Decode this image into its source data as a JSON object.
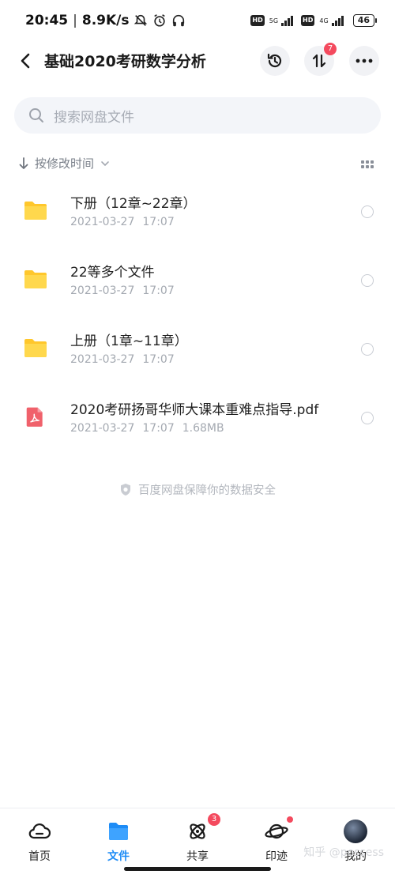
{
  "status_bar": {
    "time": "20:45",
    "net_speed": "8.9K/s",
    "battery": "46",
    "sim1": {
      "badge": "HD",
      "net": "5G"
    },
    "sim2": {
      "badge": "HD",
      "net": "4G"
    }
  },
  "header": {
    "title": "基础2020考研数学分析",
    "transfer_badge": "7"
  },
  "search": {
    "placeholder": "搜索网盘文件"
  },
  "sort": {
    "label": "按修改时间"
  },
  "files": [
    {
      "name": "下册（12章~22章）",
      "date": "2021-03-27",
      "time": "17:07",
      "size": "",
      "type": "folder"
    },
    {
      "name": "22等多个文件",
      "date": "2021-03-27",
      "time": "17:07",
      "size": "",
      "type": "folder"
    },
    {
      "name": "上册（1章~11章）",
      "date": "2021-03-27",
      "time": "17:07",
      "size": "",
      "type": "folder"
    },
    {
      "name": "2020考研扬哥华师大课本重难点指导.pdf",
      "date": "2021-03-27",
      "time": "17:07",
      "size": "1.68MB",
      "type": "pdf"
    }
  ],
  "footer_note": "百度网盘保障你的数据安全",
  "bottom_nav": {
    "home": "首页",
    "files": "文件",
    "share": "共享",
    "share_badge": "3",
    "trace": "印迹",
    "mine": "我的"
  },
  "watermark": "知乎 @possess",
  "colors": {
    "accent": "#1e8cf6",
    "folder": "#ffd23d",
    "pdf": "#f0616b",
    "badge": "#f44a5e"
  }
}
